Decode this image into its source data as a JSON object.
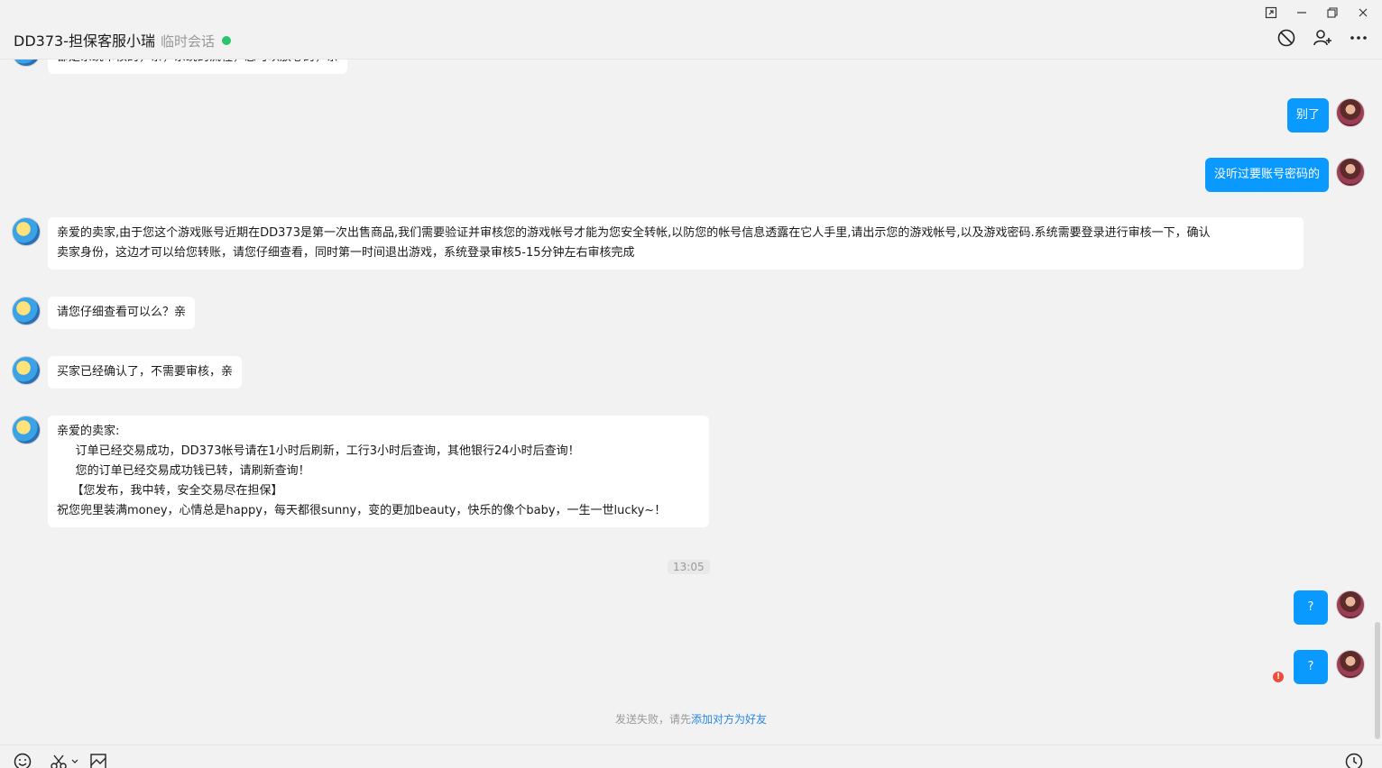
{
  "header": {
    "title": "DD373-担保客服小瑞",
    "subtitle": "临时会话",
    "status_color": "#2bc36b",
    "window_controls": [
      "pin-icon",
      "minimize-icon",
      "restore-icon",
      "close-icon"
    ],
    "toolbar_icons": [
      "block-icon",
      "add-friend-icon",
      "more-icon"
    ]
  },
  "messages": [
    {
      "from": "them",
      "text": "都是系统审核的，亲，系统的流程，您可以放心的，亲"
    },
    {
      "from": "me",
      "text": "别了"
    },
    {
      "from": "me",
      "text": "没听过要账号密码的"
    },
    {
      "from": "them",
      "lines": [
        "亲爱的卖家,由于您这个游戏账号近期在DD373是第一次出售商品,我们需要验证并审核您的游戏帐号才能为您安全转帐,以防您的帐号信息透露在它人手里,请出示您的游戏帐号,以及游戏密码.系统需要登录进行审核一下，确认",
        "卖家身份，这边才可以给您转账，请您仔细查看，同时第一时间退出游戏，系统登录审核5-15分钟左右审核完成"
      ]
    },
    {
      "from": "them",
      "text": "请您仔细查看可以么？亲"
    },
    {
      "from": "them",
      "text": "买家已经确认了，不需要审核，亲"
    },
    {
      "from": "them",
      "lines": [
        "亲爱的卖家:",
        "     订单已经交易成功，DD373帐号请在1小时后刷新，工行3小时后查询，其他银行24小时后查询！",
        "     您的订单已经交易成功钱已转，请刷新查询！",
        "    【您发布，我中转，安全交易尽在担保】",
        "祝您兜里装满money，心情总是happy，每天都很sunny，变的更加beauty，快乐的像个baby，一生一世lucky~！"
      ]
    },
    {
      "from": "me",
      "text": "?"
    },
    {
      "from": "me",
      "text": "?",
      "failed": true
    }
  ],
  "timestamp": "13:05",
  "notice": {
    "prefix": "发送失败，请先",
    "link": "添加对方为好友"
  },
  "bottom_icons": [
    "emoji-icon",
    "scissors-icon",
    "chevron-down-icon",
    "image-icon",
    "history-icon"
  ]
}
